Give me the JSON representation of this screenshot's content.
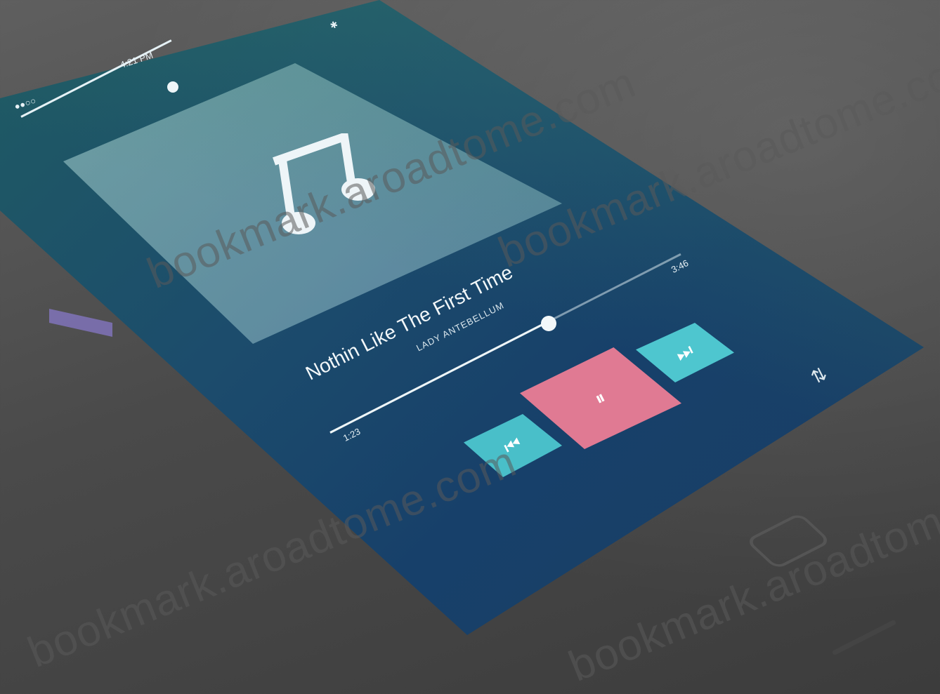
{
  "status_bar": {
    "time": "4:21 PM",
    "signal": "●●○○",
    "bluetooth": "✱"
  },
  "track": {
    "title": "Nothin Like The First Time",
    "artist": "LADY ANTEBELLUM",
    "elapsed": "1:23",
    "duration": "3:46",
    "progress": 0.62
  },
  "volume": {
    "level": 0.95
  },
  "controls": {
    "prev_icon": "⏮",
    "pause_icon": "⏸",
    "next_icon": "⏭",
    "menu_icon": "⇅"
  },
  "watermarks": [
    "bookmark.aroadtome.com",
    "bookmark.aroadtome.com",
    "bookmark.aroadtome.com",
    "bookmark.aroadtome.com"
  ],
  "colors": {
    "prev_next": "#49bfc9",
    "pause": "#e07a93",
    "screen": "#1c4c6c"
  }
}
